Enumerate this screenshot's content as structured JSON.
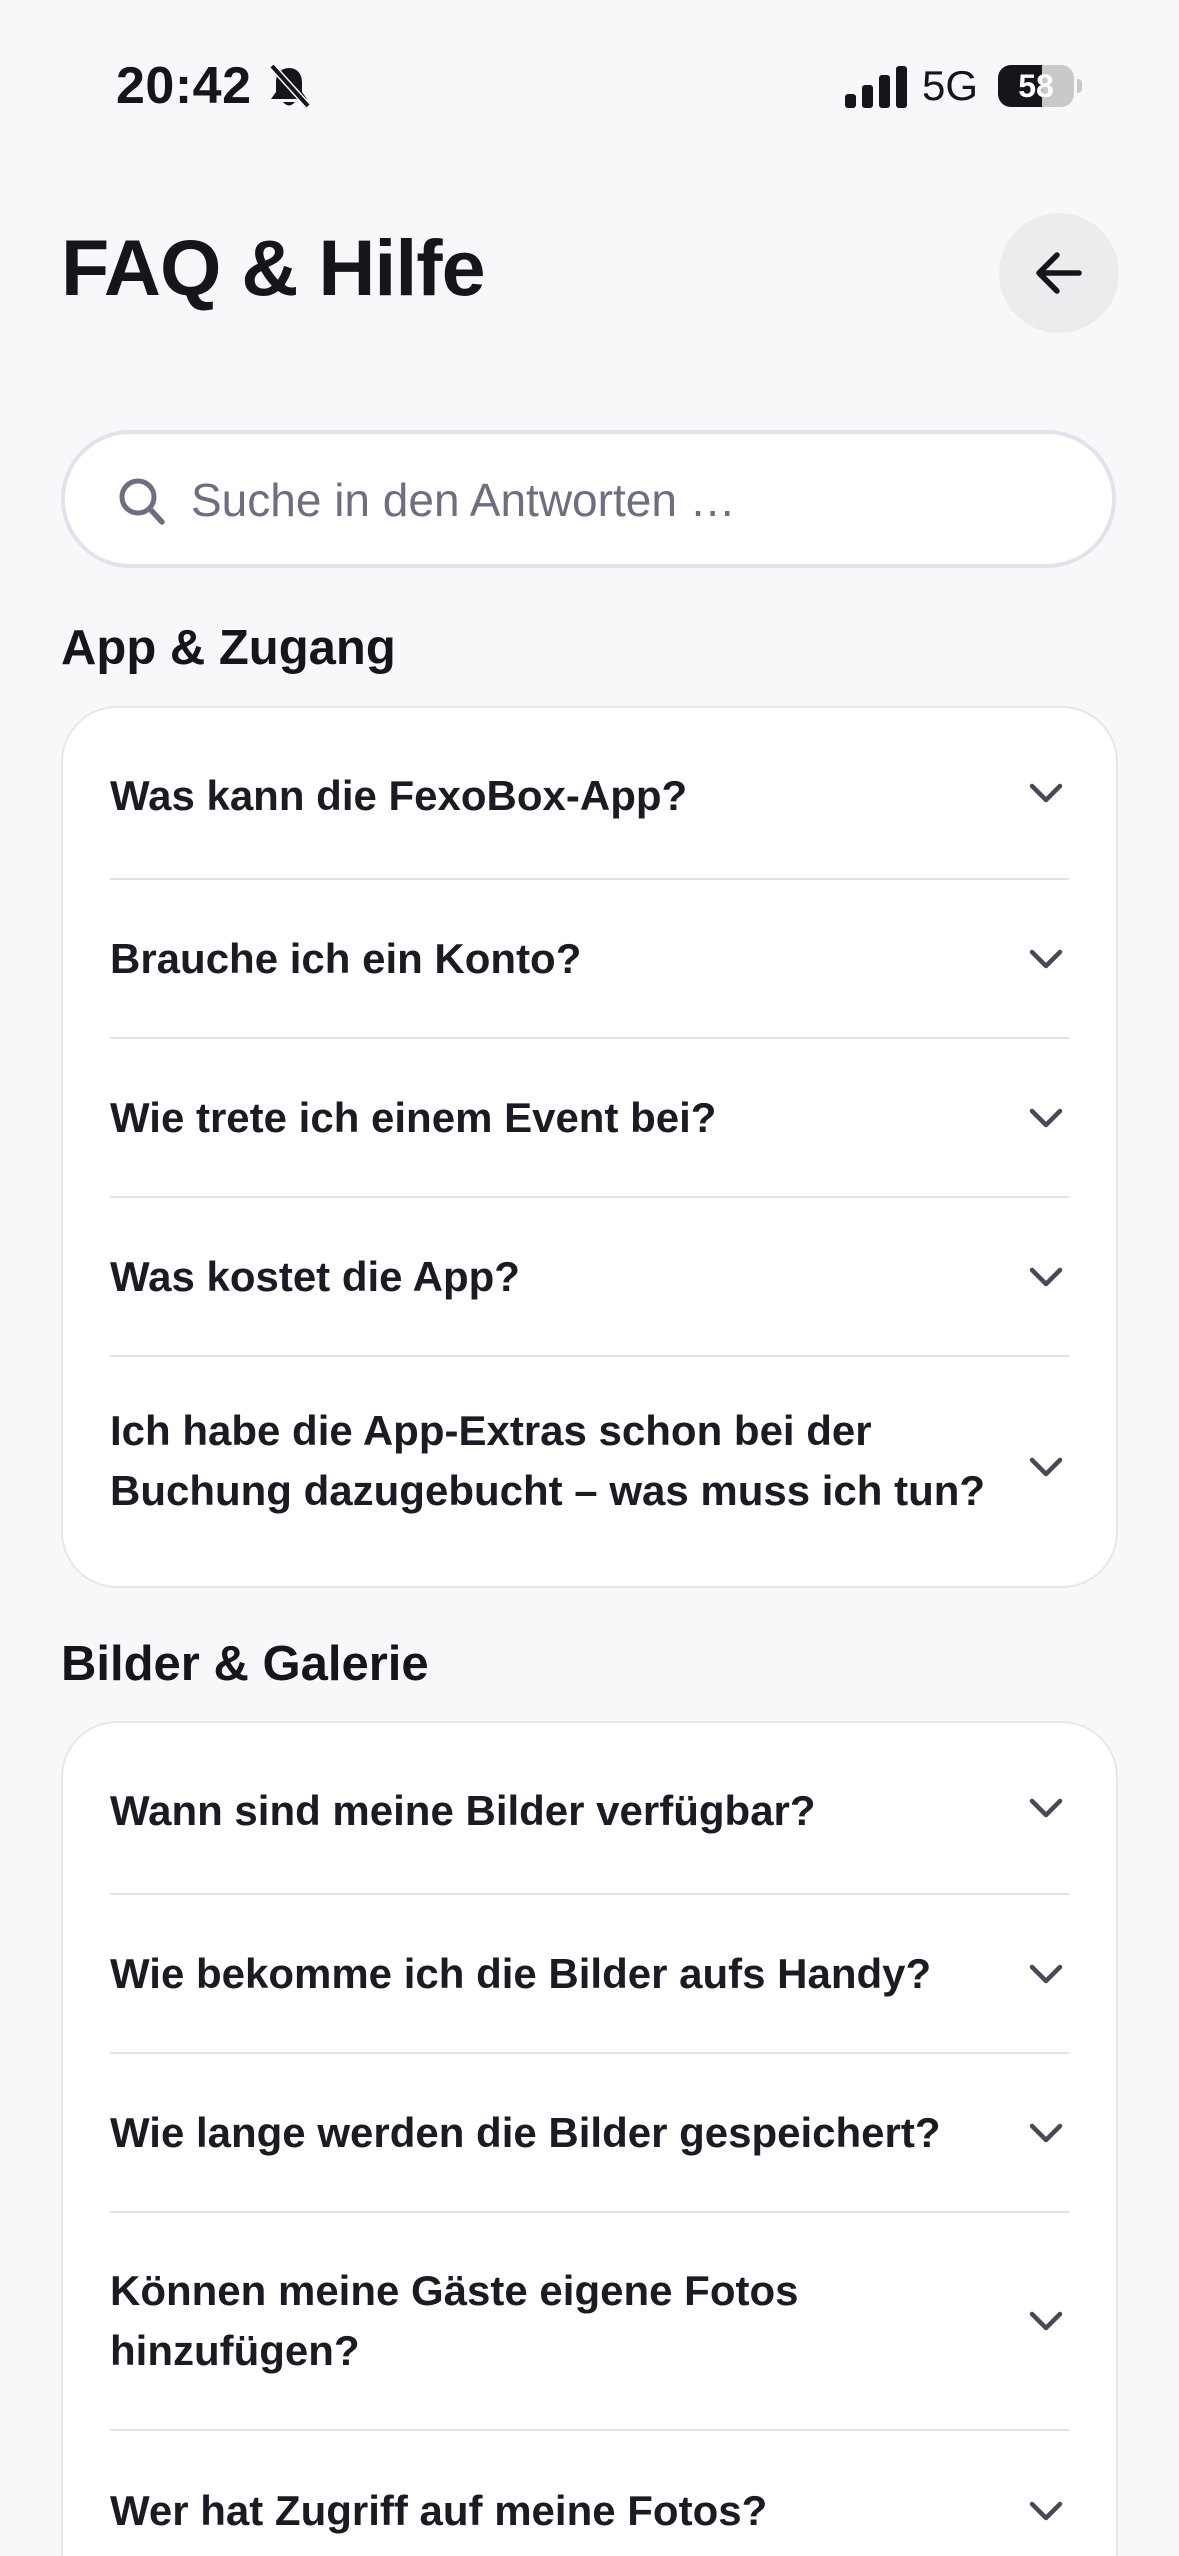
{
  "status_bar": {
    "time": "20:42",
    "network": "5G",
    "battery": "58",
    "battery_level": 0.58,
    "icons": [
      "bell-slash-icon",
      "signal-icon",
      "battery-icon"
    ]
  },
  "header": {
    "title": "FAQ & Hilfe",
    "back_icon": "arrow-left-icon"
  },
  "search": {
    "placeholder": "Suche in den Antworten …",
    "value": "",
    "icon": "search-icon"
  },
  "sections": [
    {
      "title": "App & Zugang",
      "items": [
        {
          "question": "Was kann die FexoBox-App?"
        },
        {
          "question": "Brauche ich ein Konto?"
        },
        {
          "question": "Wie trete ich einem Event bei?"
        },
        {
          "question": "Was kostet die App?"
        },
        {
          "question": "Ich habe die App-Extras schon bei der Buchung dazugebucht – was muss ich tun?"
        }
      ]
    },
    {
      "title": "Bilder & Galerie",
      "items": [
        {
          "question": "Wann sind meine Bilder verfügbar?"
        },
        {
          "question": "Wie bekomme ich die Bilder aufs Handy?"
        },
        {
          "question": "Wie lange werden die Bilder gespeichert?"
        },
        {
          "question": "Können meine Gäste eigene Fotos hinzufügen?"
        },
        {
          "question": "Wer hat Zugriff auf meine Fotos?"
        }
      ]
    }
  ],
  "colors": {
    "background": "#f8f8fa",
    "text": "#16151c",
    "muted": "#6f6d80",
    "card": "#ffffff",
    "divider": "#e3e2e8",
    "button_bg": "#ececef"
  }
}
